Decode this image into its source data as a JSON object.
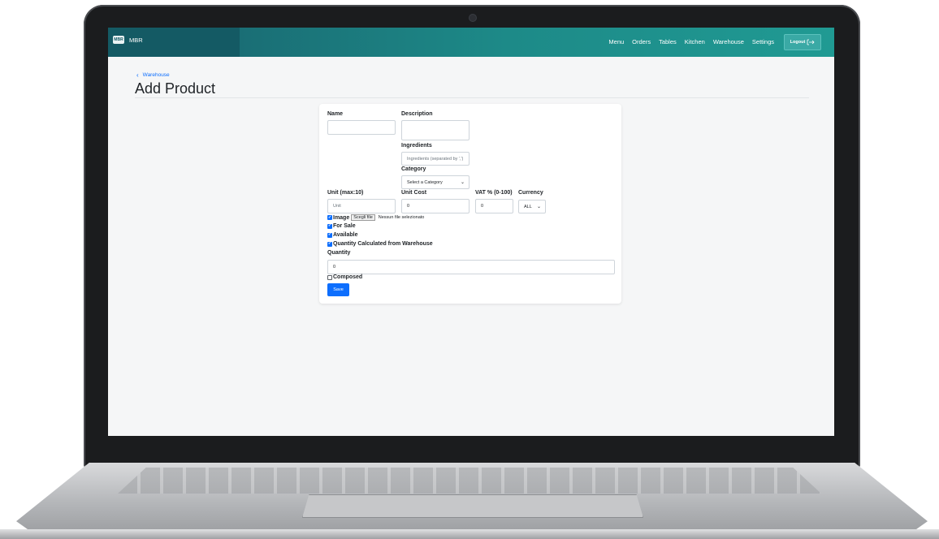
{
  "app": {
    "brand": "MBR",
    "logo_text": "MBR"
  },
  "nav": {
    "items": [
      "Menu",
      "Orders",
      "Tables",
      "Kitchen",
      "Warehouse",
      "Settings"
    ],
    "logout_label": "Logout"
  },
  "breadcrumb": {
    "back_label": "Warehouse"
  },
  "page": {
    "title": "Add Product"
  },
  "form": {
    "name_label": "Name",
    "name_value": "",
    "description_label": "Description",
    "description_value": "",
    "ingredients_label": "Ingredients",
    "ingredients_placeholder": "Ingredients (separated by ',')",
    "category_label": "Category",
    "category_selected": "Select a Category",
    "unit_label": "Unit (max:10)",
    "unit_placeholder": "Unit",
    "unit_cost_label": "Unit Cost",
    "unit_cost_value": "0",
    "vat_label": "VAT % (0-100)",
    "vat_value": "0",
    "currency_label": "Currency",
    "currency_selected": "ALL",
    "image_label": "Image",
    "image_checked": true,
    "file_button_label": "Scegli file",
    "file_status": "Nessun file selezionato",
    "for_sale_label": "For Sale",
    "for_sale_checked": true,
    "available_label": "Available",
    "available_checked": true,
    "qty_from_warehouse_label": "Quantity Calculated from Warehouse",
    "qty_from_warehouse_checked": true,
    "quantity_label": "Quantity",
    "quantity_value": "0",
    "composed_label": "Composed",
    "composed_checked": false,
    "save_label": "Save"
  },
  "colors": {
    "accent": "#0d6efd",
    "navbar": "#1d8a88"
  }
}
